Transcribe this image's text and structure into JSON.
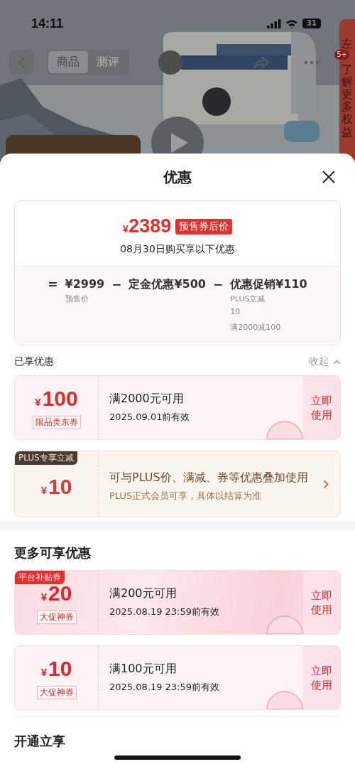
{
  "status_bar": {
    "time": "14:11",
    "battery": "31"
  },
  "nav": {
    "tabs": [
      {
        "label": "商品",
        "selected": true
      },
      {
        "label": "测评",
        "selected": false
      }
    ]
  },
  "side_banner": {
    "text_top": "左",
    "badge": "5+",
    "text_rest": "了解更多权益"
  },
  "sheet": {
    "title": "优惠"
  },
  "summary": {
    "price_symbol": "¥",
    "price": "2389",
    "price_tag": "预售券后价",
    "subtitle": "08月30日购买享以下优惠",
    "terms": [
      {
        "op": "=",
        "label": "¥2999",
        "notes": [
          "预售价"
        ]
      },
      {
        "op": "−",
        "label": "定金优惠¥500"
      },
      {
        "op": "−",
        "label": "优惠促销¥110",
        "notes": [
          "PLUS立减",
          "10",
          "满2000减100"
        ]
      }
    ]
  },
  "sections": [
    {
      "title": "已享优惠",
      "toggle": "收起",
      "expanded": true,
      "coupons": [
        {
          "kind": "coupon",
          "symbol": "¥",
          "amount": "100",
          "tag": "限品类东券",
          "condition": "满2000元可用",
          "validity": "2025.09.01前有效",
          "action": "立即使用",
          "featured": false
        },
        {
          "kind": "plus",
          "corner": "PLUS专享立减",
          "symbol": "¥",
          "amount": "10",
          "condition": "可与PLUS价、满减、券等优惠叠加使用",
          "validity": "PLUS正式会员可享，具体以结算为准"
        }
      ]
    },
    {
      "title": "更多可享优惠",
      "coupons": [
        {
          "kind": "coupon",
          "corner": "平台补贴券",
          "symbol": "¥",
          "amount": "20",
          "tag": "大促神券",
          "condition": "满200元可用",
          "validity": "2025.08.19 23:59前有效",
          "action": "立即使用",
          "featured": true
        },
        {
          "kind": "coupon",
          "symbol": "¥",
          "amount": "10",
          "tag": "大促神券",
          "condition": "满100元可用",
          "validity": "2025.08.19 23:59前有效",
          "action": "立即使用",
          "featured": false
        }
      ]
    }
  ],
  "next_section": {
    "title": "开通立享"
  }
}
